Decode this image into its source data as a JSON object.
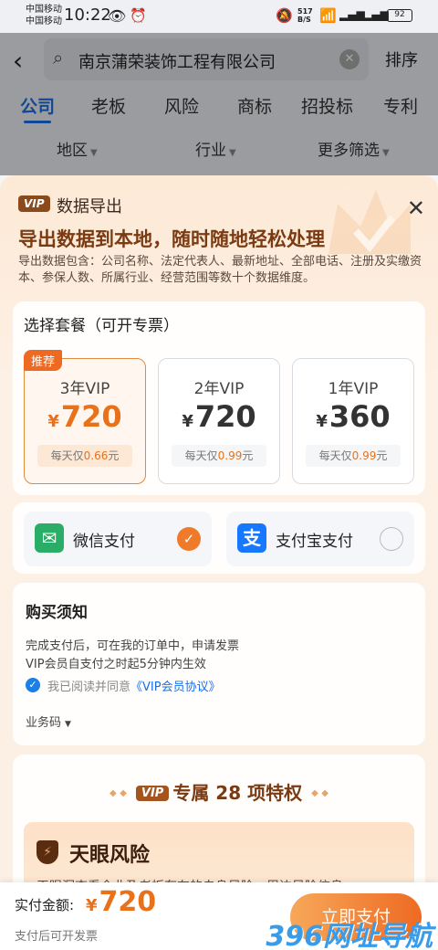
{
  "status_bar": {
    "carrier_1": "中国移动",
    "carrier_2": "中国移动",
    "time": "10:22",
    "net_speed_value": "517",
    "net_speed_unit": "B/S",
    "battery": "92"
  },
  "header": {
    "search_query": "南京蒲荣装饰工程有限公司",
    "sort_label": "排序",
    "tabs": [
      {
        "label": "公司",
        "active": true
      },
      {
        "label": "老板",
        "active": false
      },
      {
        "label": "风险",
        "active": false
      },
      {
        "label": "商标",
        "active": false
      },
      {
        "label": "招投标",
        "active": false
      },
      {
        "label": "专利",
        "active": false
      }
    ],
    "filters": [
      "地区",
      "行业",
      "更多筛选"
    ]
  },
  "sheet": {
    "vip_badge": "VIP",
    "title": "数据导出",
    "headline": "导出数据到本地，随时随地轻松处理",
    "description": "导出数据包含：公司名称、法定代表人、最新地址、全部电话、注册及实缴资本、参保人数、所属行业、经营范围等数十个数据维度。",
    "plan_section_title": "选择套餐（可开专票）",
    "plans": [
      {
        "tag": "推荐",
        "name": "3年VIP",
        "currency": "¥",
        "price": "720",
        "daily_prefix": "每天仅",
        "daily_value": "0.66",
        "daily_suffix": "元",
        "selected": true
      },
      {
        "tag": "",
        "name": "2年VIP",
        "currency": "¥",
        "price": "720",
        "daily_prefix": "每天仅",
        "daily_value": "0.99",
        "daily_suffix": "元",
        "selected": false
      },
      {
        "tag": "",
        "name": "1年VIP",
        "currency": "¥",
        "price": "360",
        "daily_prefix": "每天仅",
        "daily_value": "0.99",
        "daily_suffix": "元",
        "selected": false
      }
    ],
    "payment": [
      {
        "label": "微信支付",
        "icon": "wechat-pay-icon",
        "color": "#2aae67",
        "selected": true
      },
      {
        "label": "支付宝支付",
        "icon": "alipay-icon",
        "color": "#1677ff",
        "selected": false
      }
    ],
    "notice": {
      "title": "购买须知",
      "line_1": "完成支付后，可在我的订单中，申请发票",
      "line_2": "VIP会员自支付之时起5分钟内生效",
      "agree_prefix": "我已阅读并同意",
      "agree_link": "《VIP会员协议》",
      "biz_code": "业务码"
    },
    "privileges": {
      "vip_badge": "VIP",
      "title": "专属 28 项特权",
      "risk_title": "天眼风险",
      "risk_desc": "天眼洞查看企业及老板存在的自身风险、周边风险信息"
    }
  },
  "bottom_bar": {
    "amount_label": "实付金额:",
    "currency": "¥",
    "amount": "720",
    "invoice_note": "支付后可开发票",
    "buy_button": "立即支付"
  },
  "watermark": "396网址导航",
  "colors": {
    "accent_blue": "#1a6fe6",
    "accent_orange": "#ee6a22",
    "vip_brown": "#8b4a1c"
  }
}
